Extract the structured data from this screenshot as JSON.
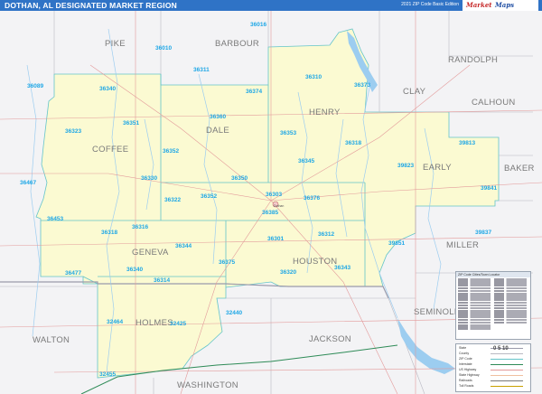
{
  "header": {
    "title": "DOTHAN, AL DESIGNATED MARKET REGION",
    "edition": "2021 ZIP Code Basic Edition",
    "brand": "Market Maps"
  },
  "colors": {
    "header_bg": "#2f73c6",
    "region_fill": "#fbfad2",
    "outside_fill": "#f3f3f5",
    "zip_text": "#1ea7e6",
    "county_text": "#7a7a7a",
    "water": "#9ccdf0",
    "county_border": "#64c4c9"
  },
  "counties": {
    "pike": "PIKE",
    "barbour": "BARBOUR",
    "randolph": "RANDOLPH",
    "henry": "HENRY",
    "clay": "CLAY",
    "dale": "DALE",
    "calhoun": "CALHOUN",
    "coffee": "COFFEE",
    "early": "EARLY",
    "baker": "BAKER",
    "geneva": "GENEVA",
    "houston": "HOUSTON",
    "miller": "MILLER",
    "seminole": "SEMINOLE",
    "holmes": "HOLMES",
    "walton": "WALTON",
    "jackson": "JACKSON",
    "washington": "WASHINGTON"
  },
  "zips": [
    "36016",
    "36010",
    "36311",
    "36089",
    "36340",
    "36374",
    "36310",
    "36373",
    "36351",
    "36360",
    "36323",
    "36353",
    "36318",
    "39813",
    "36352",
    "36345",
    "39823",
    "36467",
    "36330",
    "36350",
    "36303",
    "36376",
    "39841",
    "36453",
    "36322",
    "36352",
    "36385",
    "36316",
    "36318",
    "36312",
    "39837",
    "36344",
    "36301",
    "39851",
    "36375",
    "36343",
    "36477",
    "36340",
    "36320",
    "36314",
    "32464",
    "32425",
    "32440",
    "32455"
  ],
  "city": "Dothan",
  "legend": {
    "title": "ZIP Code Cities/Town Locator",
    "keys": [
      "State",
      "County",
      "ZIP Code",
      "Interstate",
      "US Highway",
      "State Highway",
      "Railroads",
      "Toll Roads"
    ]
  },
  "scale_label": "0 5 10"
}
